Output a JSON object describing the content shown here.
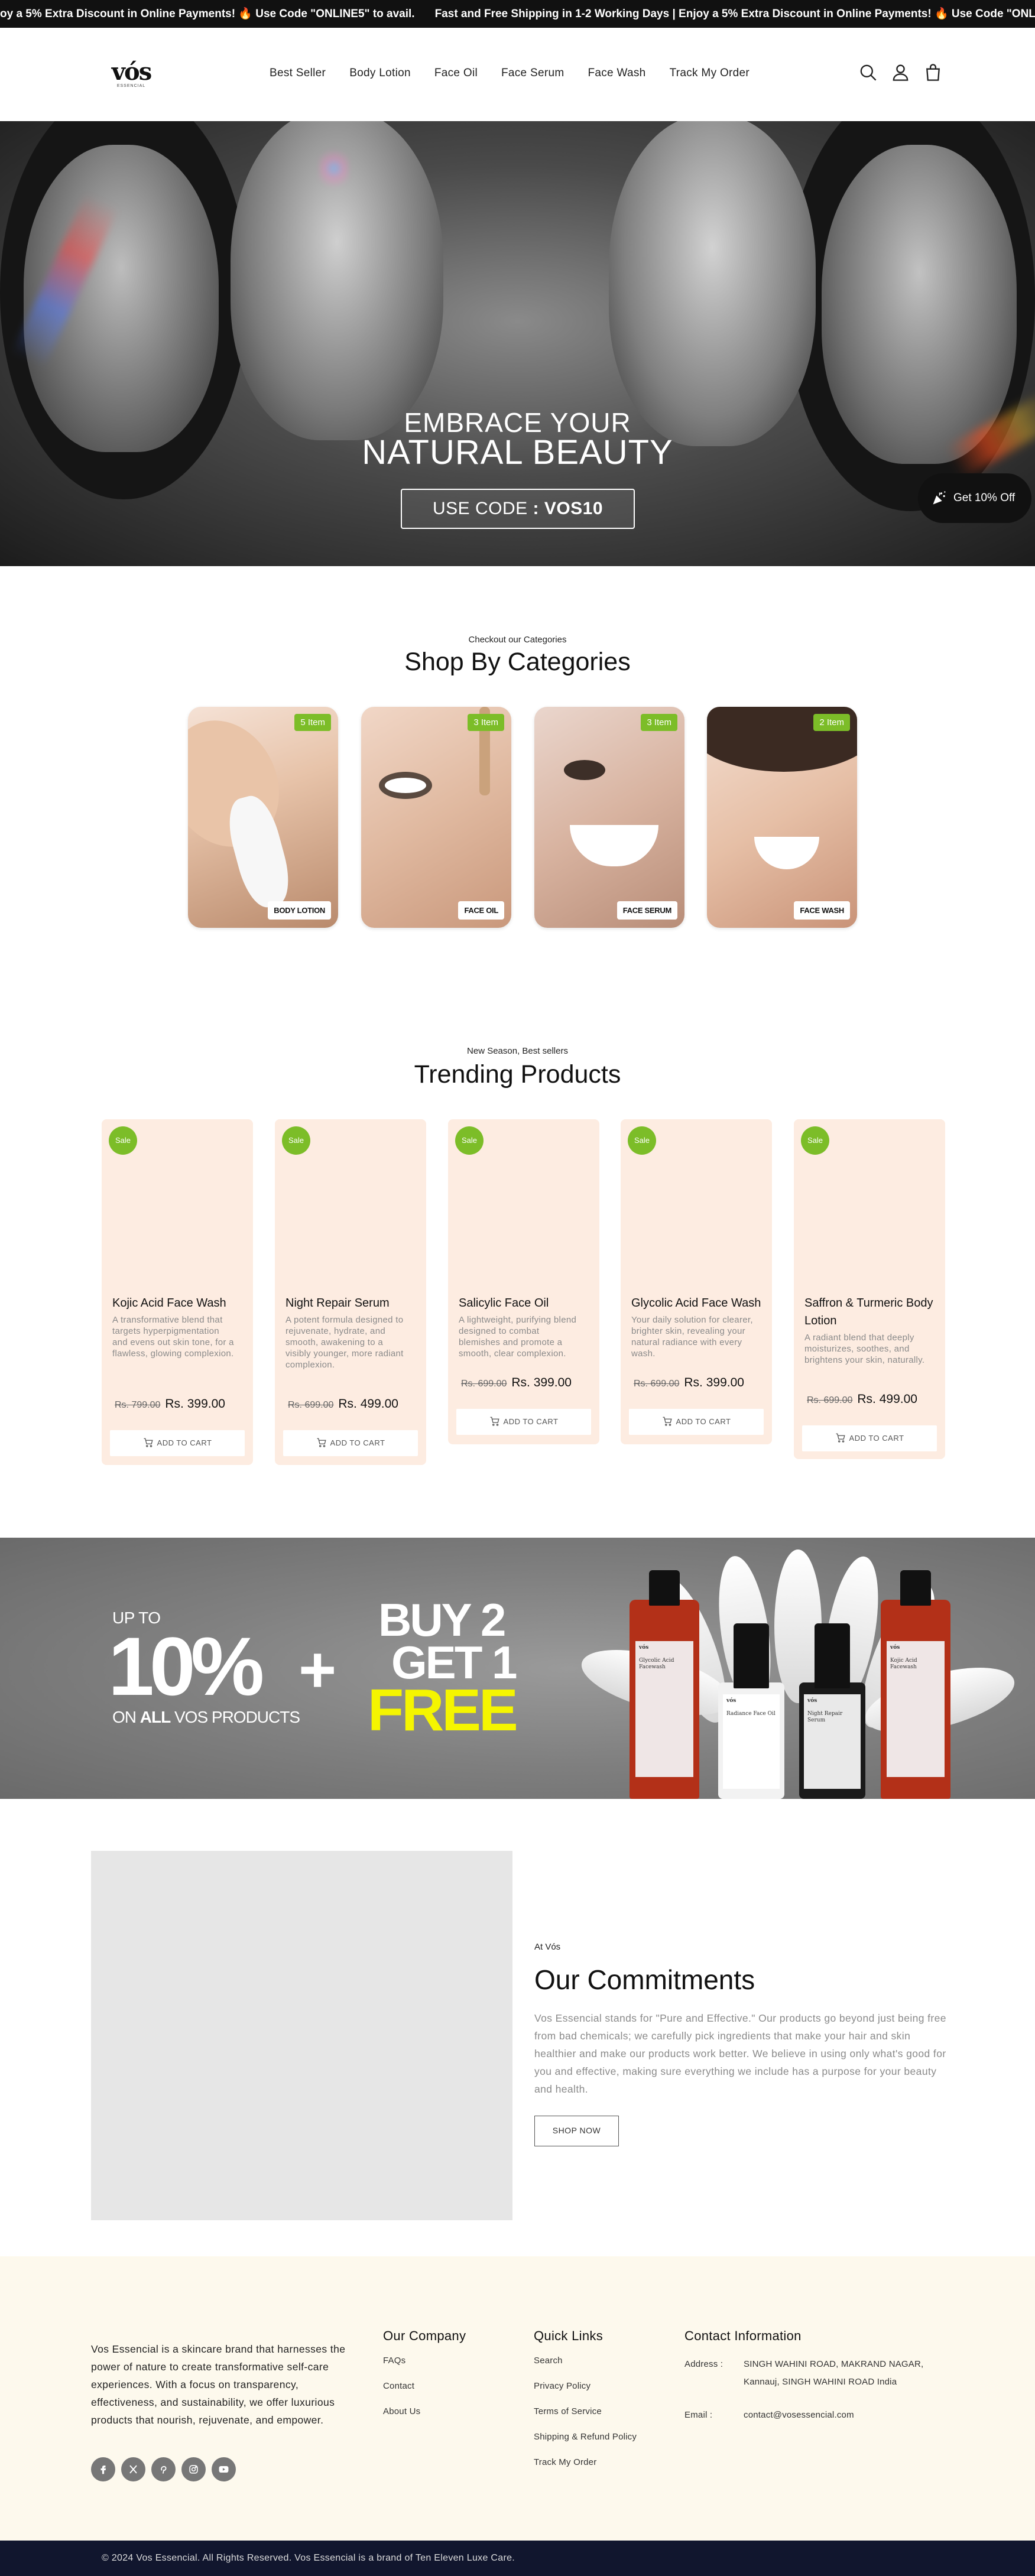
{
  "announcement": {
    "items": [
      "oy a 5% Extra Discount in Online Payments! 🔥 Use Code \"ONLINE5\" to avail.",
      "Fast and Free Shipping in 1-2 Working Days | Enjoy a 5% Extra Discount in Online Payments! 🔥 Use Code \"ONLINE5\" to a"
    ]
  },
  "header": {
    "logo_main": "vós",
    "logo_sub": "ESSENCIAL",
    "nav": [
      "Best Seller",
      "Body Lotion",
      "Face Oil",
      "Face Serum",
      "Face Wash",
      "Track My Order"
    ],
    "icons": [
      "search-icon",
      "account-icon",
      "cart-icon"
    ]
  },
  "hero": {
    "line1": "EMBRACE YOUR",
    "line2": "NATURAL BEAUTY",
    "code_prefix": "USE CODE",
    "code_sep": " : ",
    "code": "VOS10",
    "offer_button": "Get 10% Off"
  },
  "categories": {
    "kicker": "Checkout our Categories",
    "title": "Shop By Categories",
    "items": [
      {
        "count": "5 Item",
        "label": "BODY LOTION"
      },
      {
        "count": "3 Item",
        "label": "FACE OIL"
      },
      {
        "count": "3 Item",
        "label": "FACE SERUM"
      },
      {
        "count": "2 Item",
        "label": "FACE WASH"
      }
    ]
  },
  "trending": {
    "kicker": "New Season, Best sellers",
    "title": "Trending Products",
    "sale_label": "Sale",
    "cart_label": "ADD TO CART",
    "products": [
      {
        "name": "Kojic Acid Face Wash",
        "desc": "A transformative blend that targets hyperpigmentation and evens out skin tone, for a flawless, glowing complexion.",
        "old_price": "Rs. 799.00",
        "price": "Rs. 399.00"
      },
      {
        "name": "Night Repair Serum",
        "desc": "A potent formula designed to rejuvenate, hydrate, and smooth, awakening to a visibly younger, more radiant complexion.",
        "old_price": "Rs. 699.00",
        "price": "Rs. 499.00"
      },
      {
        "name": "Salicylic Face Oil",
        "desc": "A lightweight, purifying blend designed to combat blemishes and promote a smooth, clear complexion.",
        "old_price": "Rs. 699.00",
        "price": "Rs. 399.00"
      },
      {
        "name": "Glycolic Acid Face Wash",
        "desc": "Your daily solution for clearer, brighter skin, revealing your natural radiance with every wash.",
        "old_price": "Rs. 699.00",
        "price": "Rs. 399.00"
      },
      {
        "name": "Saffron & Turmeric Body Lotion",
        "desc": "A radiant blend that deeply moisturizes, soothes, and brightens your skin, naturally.",
        "old_price": "Rs. 699.00",
        "price": "Rs. 499.00"
      }
    ]
  },
  "promo": {
    "upto": "UP TO",
    "percent": "10%",
    "on_all_prefix": "ON ",
    "on_all_bold": "ALL",
    "on_all_suffix": " VOS PRODUCTS",
    "plus": "+",
    "buy": "BUY 2",
    "get": "GET 1",
    "free": "FREE",
    "bottles": [
      {
        "brand": "vós",
        "label": "Glycolic Acid Facewash"
      },
      {
        "brand": "vós",
        "label": "Radiance Face Oil"
      },
      {
        "brand": "vós",
        "label": "Night Repair Serum"
      },
      {
        "brand": "vós",
        "label": "Kojic Acid Facewash"
      }
    ]
  },
  "commitments": {
    "kicker": "At Vós",
    "title": "Our Commitments",
    "body": "Vos Essencial stands for \"Pure and Effective.\" Our products go beyond just being free from bad chemicals; we carefully pick ingredients that make your hair and skin healthier and make our products work better. We believe in using only what's good for you and effective, making sure everything we include has a purpose for your beauty and health.",
    "button": "SHOP NOW"
  },
  "footer": {
    "about": "Vos Essencial is a skincare brand that harnesses the power of nature to create transformative self-care experiences. With a focus on transparency, effectiveness, and sustainability, we offer luxurious products that nourish, rejuvenate, and empower.",
    "social": [
      "facebook-icon",
      "x-icon",
      "pinterest-icon",
      "instagram-icon",
      "youtube-icon"
    ],
    "company": {
      "title": "Our Company",
      "links": [
        "FAQs",
        "Contact",
        "About Us"
      ]
    },
    "quick": {
      "title": "Quick Links",
      "links": [
        "Search",
        "Privacy Policy",
        "Terms of Service",
        "Shipping & Refund Policy",
        "Track My Order"
      ]
    },
    "contact": {
      "title": "Contact Information",
      "address_label": "Address :",
      "address": "SINGH WAHINI ROAD, MAKRAND NAGAR, Kannauj, SINGH WAHINI ROAD India",
      "email_label": "Email :",
      "email": "contact@vosessencial.com"
    },
    "copyright": "© 2024 Vos Essencial. All Rights Reserved. Vos Essencial is a brand of Ten Eleven Luxe Care."
  },
  "colors": {
    "accent_green": "#7cbd28",
    "announcement_bg": "#111111",
    "product_card_bg": "#fdece1",
    "footer_bg": "#fdf9ed",
    "copyright_bg": "#11162e",
    "promo_free": "#f5f500"
  }
}
